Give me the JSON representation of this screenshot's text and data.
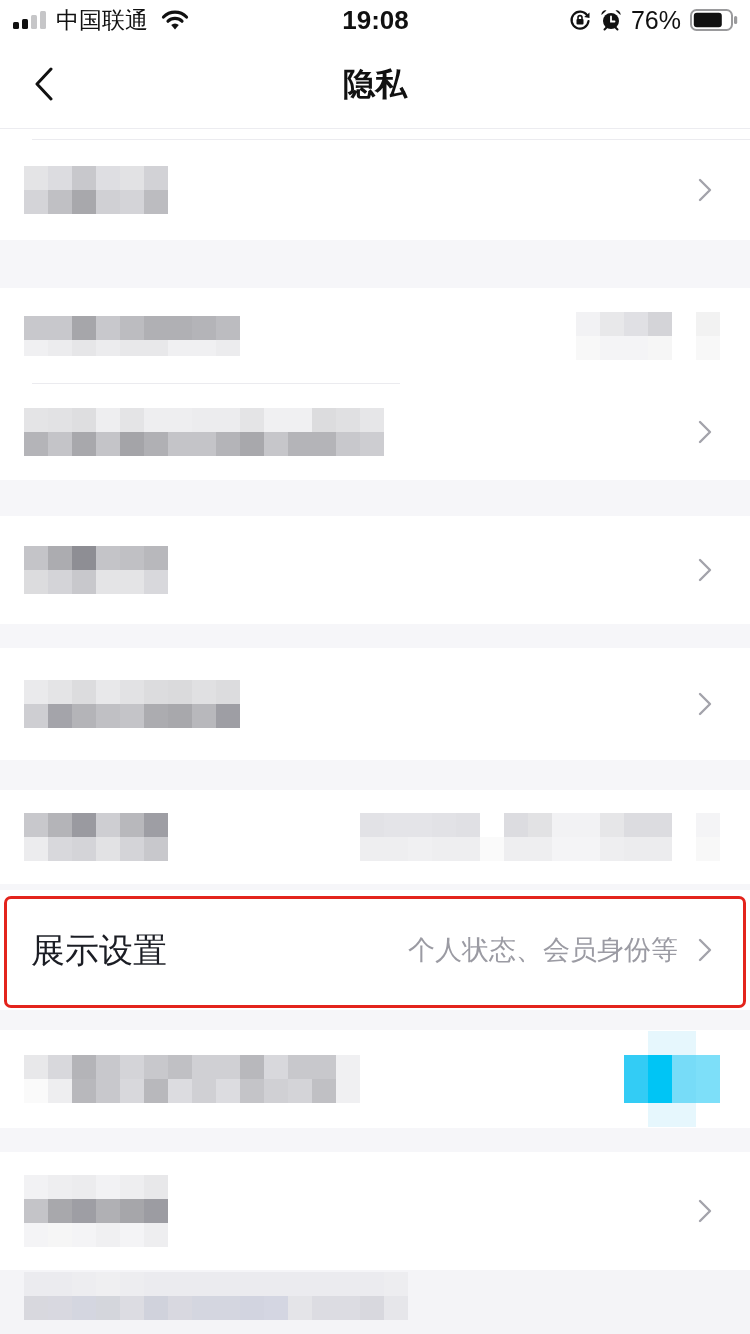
{
  "status_bar": {
    "carrier": "中国联通",
    "time": "19:08",
    "battery": "76%"
  },
  "nav_bar": {
    "title": "隐私"
  },
  "sections": [
    {
      "rows": [
        {
          "kind": "link",
          "redacted": true
        }
      ]
    },
    {
      "rows": [
        {
          "kind": "value",
          "redacted": true
        },
        {
          "kind": "link",
          "redacted": true
        }
      ]
    },
    {
      "rows": [
        {
          "kind": "link",
          "redacted": true
        }
      ]
    },
    {
      "rows": [
        {
          "kind": "link",
          "redacted": true
        }
      ]
    },
    {
      "rows": [
        {
          "kind": "value",
          "redacted": true
        }
      ]
    },
    {
      "rows": [
        {
          "kind": "link",
          "redacted": false,
          "label": "展示设置",
          "detail": "个人状态、会员身份等",
          "highlighted": true
        }
      ]
    },
    {
      "rows": [
        {
          "kind": "switch",
          "redacted": true,
          "on": true
        }
      ]
    },
    {
      "rows": [
        {
          "kind": "link",
          "redacted": true
        }
      ]
    }
  ],
  "footer": {
    "redacted": true
  }
}
